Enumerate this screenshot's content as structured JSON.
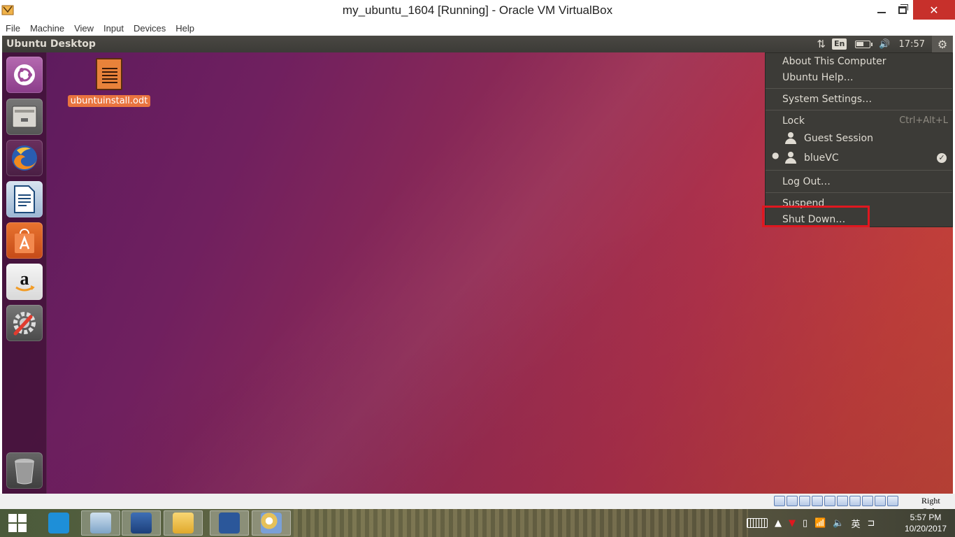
{
  "window": {
    "title": "my_ubuntu_1604 [Running] - Oracle VM VirtualBox",
    "menu": [
      "File",
      "Machine",
      "View",
      "Input",
      "Devices",
      "Help"
    ],
    "controls": {
      "close": "✕"
    }
  },
  "ubuntu": {
    "panel_title": "Ubuntu Desktop",
    "indicators": {
      "language": "En",
      "battery_level": 0.6,
      "clock": "17:57"
    },
    "launcher": [
      "dash-home",
      "files",
      "firefox",
      "libreoffice-writer",
      "ubuntu-software",
      "amazon",
      "system-settings",
      "trash"
    ],
    "desktop_file": {
      "name": "ubuntuinstall.odt"
    },
    "session_menu": {
      "about": "About This Computer",
      "help": "Ubuntu Help…",
      "settings": "System Settings…",
      "lock": "Lock",
      "lock_accel": "Ctrl+Alt+L",
      "guest": "Guest Session",
      "user": "blueVC",
      "logout": "Log Out…",
      "suspend": "Suspend",
      "shutdown": "Shut Down…"
    }
  },
  "vbox_status": {
    "host_key": "Right Ctrl"
  },
  "taskbar": {
    "apps": [
      "touch-keyboard",
      "this-pc",
      "virtualbox",
      "file-explorer",
      "word",
      "paint"
    ],
    "tray": {
      "ime": "英"
    },
    "clock": {
      "time": "5:57 PM",
      "date": "10/20/2017"
    }
  },
  "colors": {
    "ubuntu_panel": "#3c3b37",
    "highlight_box": "#e0171f",
    "desktop_label": "#e9743f"
  }
}
